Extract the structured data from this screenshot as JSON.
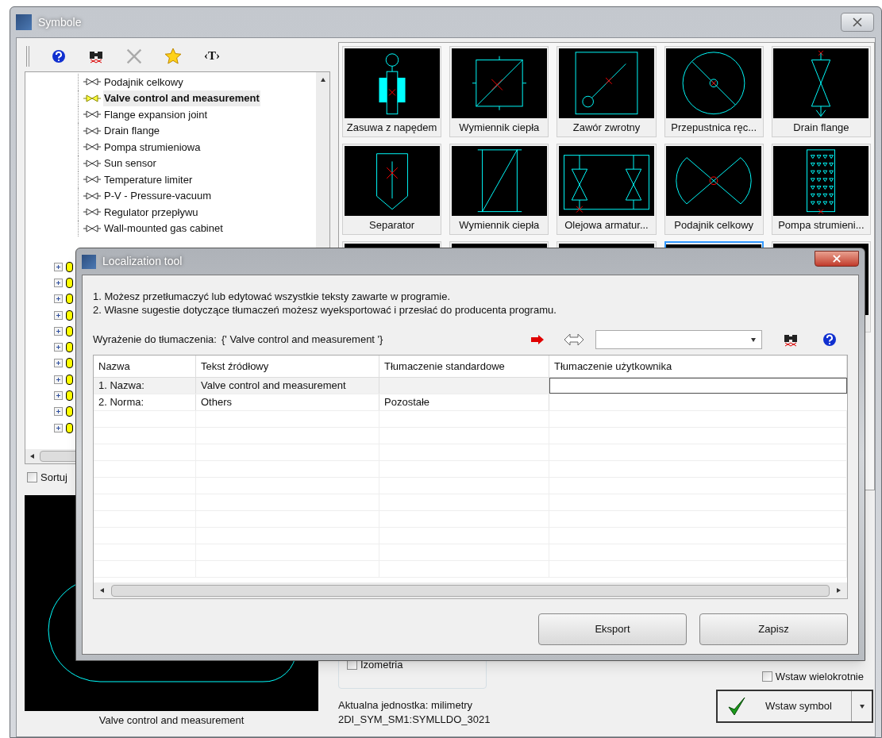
{
  "window": {
    "title": "Symbole",
    "toolbar": {
      "text_tool": "‹T›"
    },
    "tree": {
      "items": [
        {
          "label": "Podajnik celkowy",
          "selected": false
        },
        {
          "label": "Valve control and measurement",
          "selected": true
        },
        {
          "label": "Flange expansion joint",
          "selected": false
        },
        {
          "label": "Drain flange",
          "selected": false
        },
        {
          "label": "Pompa strumieniowa",
          "selected": false
        },
        {
          "label": "Sun sensor",
          "selected": false
        },
        {
          "label": "Temperature limiter",
          "selected": false
        },
        {
          "label": "P-V - Pressure-vacuum",
          "selected": false
        },
        {
          "label": "Regulator przepływu",
          "selected": false
        },
        {
          "label": "Wall-mounted gas cabinet",
          "selected": false
        }
      ],
      "folders": [
        {
          "expanded": false
        },
        {
          "expanded": false
        },
        {
          "expanded": false
        },
        {
          "expanded": false
        },
        {
          "expanded": false
        },
        {
          "expanded": false
        },
        {
          "expanded": false
        },
        {
          "expanded": false
        },
        {
          "expanded": false
        },
        {
          "expanded": false
        },
        {
          "expanded": false
        }
      ]
    },
    "sort": {
      "label": "Sortuj",
      "checked": false
    },
    "preview_caption": "Valve control and measurement",
    "symbols": [
      {
        "kind": "drive-valve",
        "label": "Zasuwa z napędem",
        "selected": false
      },
      {
        "kind": "square-exchanger",
        "label": "Wymiennik ciepła",
        "selected": false
      },
      {
        "kind": "check-valve",
        "label": "Zawór zwrotny",
        "selected": false
      },
      {
        "kind": "damper",
        "label": "Przepustnica ręc...",
        "selected": false
      },
      {
        "kind": "drain",
        "label": "Drain flange",
        "selected": false
      },
      {
        "kind": "separator",
        "label": "Separator",
        "selected": false
      },
      {
        "kind": "rect-exchanger",
        "label": "Wymiennik ciepła",
        "selected": false
      },
      {
        "kind": "twin-valve",
        "label": "Olejowa armatur...",
        "selected": false
      },
      {
        "kind": "feeder",
        "label": "Podajnik celkowy",
        "selected": false
      },
      {
        "kind": "jet-pump",
        "label": "Pompa strumieni...",
        "selected": false
      },
      {
        "kind": "covered",
        "selected": false
      },
      {
        "kind": "covered",
        "selected": false
      },
      {
        "kind": "covered",
        "selected": false
      },
      {
        "kind": "covered",
        "selected": true
      },
      {
        "kind": "covered",
        "selected": false
      }
    ],
    "isometry": {
      "label": "Izometria",
      "checked": false
    },
    "unit": "Aktualna jednostka: milimetry",
    "symbol_code": "2DI_SYM_SM1:SYMLLDO_3021",
    "multi_insert": {
      "label": "Wstaw wielokrotnie",
      "checked": false
    },
    "insert_button": "Wstaw symbol"
  },
  "dialog": {
    "title": "Localization tool",
    "instructions": [
      "1. Możesz przetłumaczyć lub edytować wszystkie teksty zawarte w programie.",
      "2. Własne sugestie dotyczące tłumaczeń możesz wyeksportować i przesłać do producenta programu."
    ],
    "expression_label": "Wyrażenie do tłumaczenia:",
    "expression_value": "{' Valve control and measurement '}",
    "table": {
      "columns": [
        "Nazwa",
        "Tekst źródłowy",
        "Tłumaczenie standardowe",
        "Tłumaczenie użytkownika"
      ],
      "rows": [
        {
          "name": "1. Nazwa:",
          "source": "Valve control and measurement",
          "editing": true,
          "selected": true
        },
        {
          "name": "2. Norma:",
          "source": "Others",
          "standard": "Pozostałe",
          "editing": false,
          "selected": false
        }
      ]
    },
    "buttons": [
      "Eksport",
      "Zapisz"
    ]
  }
}
